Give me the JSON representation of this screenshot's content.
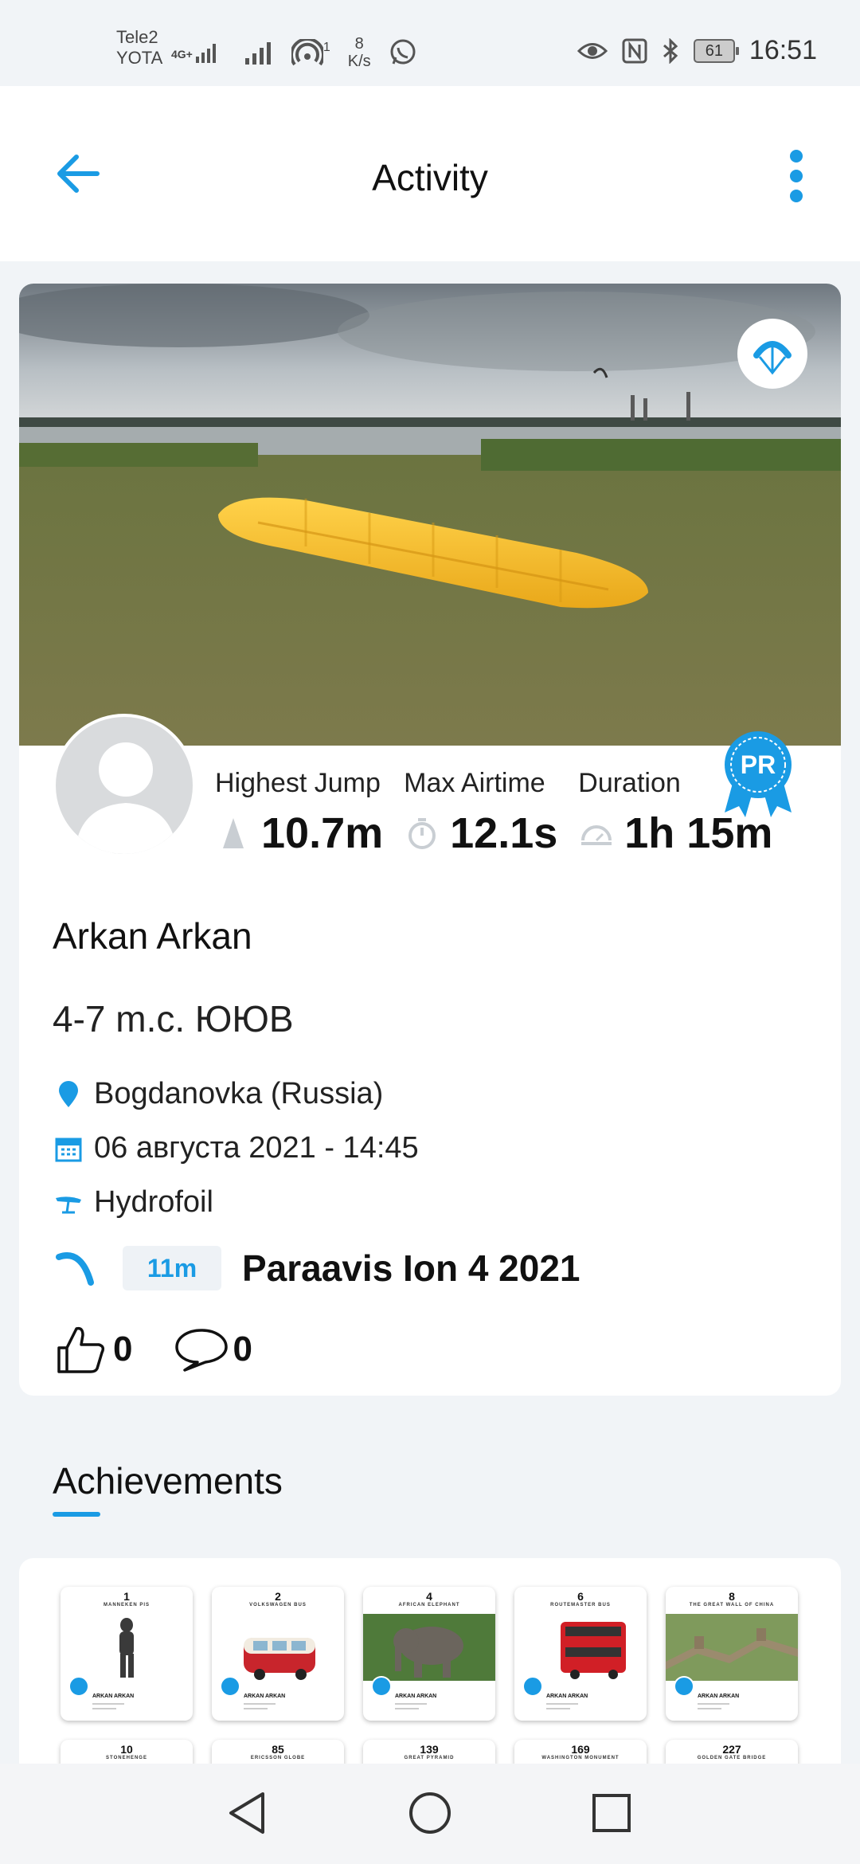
{
  "status_bar": {
    "carrier_line1": "Tele2",
    "carrier_line2": "YOTA",
    "network_type": "4G+",
    "hotspot_count": "1",
    "speed_value": "8",
    "speed_unit": "K/s",
    "battery": "61",
    "time": "16:51"
  },
  "app_bar": {
    "title": "Activity"
  },
  "activity": {
    "stats": [
      {
        "label": "Highest Jump",
        "value": "10.7m",
        "icon": "jump-icon"
      },
      {
        "label": "Max Airtime",
        "value": "12.1s",
        "icon": "stopwatch-icon"
      },
      {
        "label": "Duration",
        "value": "1h 15m",
        "icon": "duration-icon"
      }
    ],
    "pr_badge": "PR",
    "user_name": "Arkan Arkan",
    "description": "4-7 m.c. ЮЮВ",
    "location": "Bogdanovka (Russia)",
    "datetime": "06 августа 2021 - 14:45",
    "board_type": "Hydrofoil",
    "kite_size": "11m",
    "kite_name": "Paraavis Ion 4 2021",
    "likes": "0",
    "comments": "0"
  },
  "achievements": {
    "title": "Achievements",
    "row1": [
      {
        "num": "1",
        "caption": "MANNEKEN PIS"
      },
      {
        "num": "2",
        "caption": "VOLKSWAGEN BUS"
      },
      {
        "num": "4",
        "caption": "AFRICAN ELEPHANT"
      },
      {
        "num": "6",
        "caption": "ROUTEMASTER BUS"
      },
      {
        "num": "8",
        "caption": "THE GREAT WALL OF CHINA"
      }
    ],
    "row2": [
      {
        "num": "10",
        "caption": "STONEHENGE"
      },
      {
        "num": "85",
        "caption": "ERICSSON GLOBE"
      },
      {
        "num": "139",
        "caption": "GREAT PYRAMID"
      },
      {
        "num": "169",
        "caption": "WASHINGTON MONUMENT"
      },
      {
        "num": "227",
        "caption": "GOLDEN GATE BRIDGE"
      }
    ],
    "card_name": "ARKAN ARKAN"
  },
  "colors": {
    "accent": "#1a9be4",
    "background": "#f1f4f7",
    "card": "#ffffff"
  }
}
